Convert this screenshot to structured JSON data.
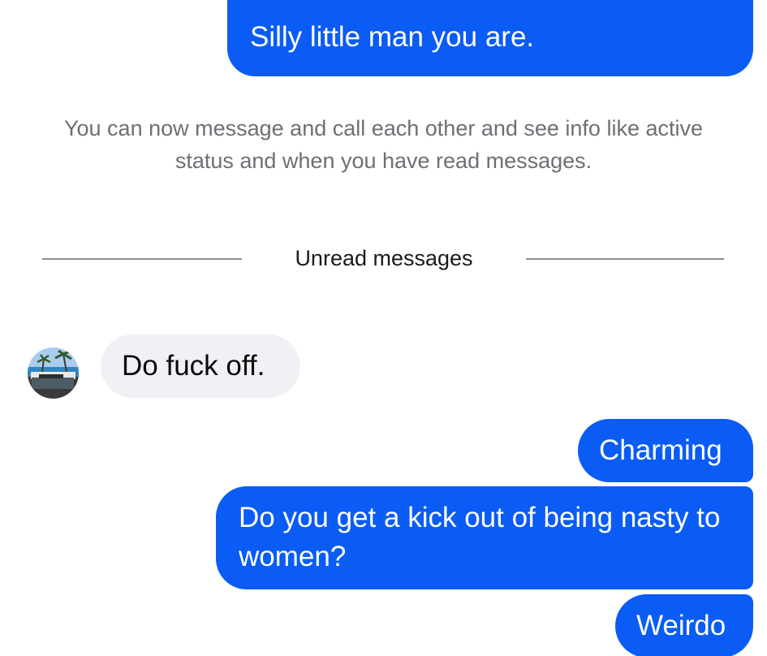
{
  "conversation": {
    "messages_before": [
      {
        "direction": "outgoing",
        "text": "Silly little man you are."
      }
    ],
    "system_notice": "You can now message and call each other and see info like active status and when you have read messages.",
    "divider_label": "Unread messages",
    "messages_after": [
      {
        "direction": "incoming",
        "text": "Do fuck off.",
        "avatar": "contact-avatar-beach-photo"
      },
      {
        "direction": "outgoing",
        "text": "Charming"
      },
      {
        "direction": "outgoing",
        "text": "Do you get a kick out of being nasty to women?"
      },
      {
        "direction": "outgoing",
        "text": "Weirdo"
      }
    ]
  },
  "colors": {
    "outgoing_bubble": "#0a5cf5",
    "incoming_bubble": "#f0f1f5",
    "notice_text": "#6d6f74",
    "divider": "#8b8d92"
  }
}
